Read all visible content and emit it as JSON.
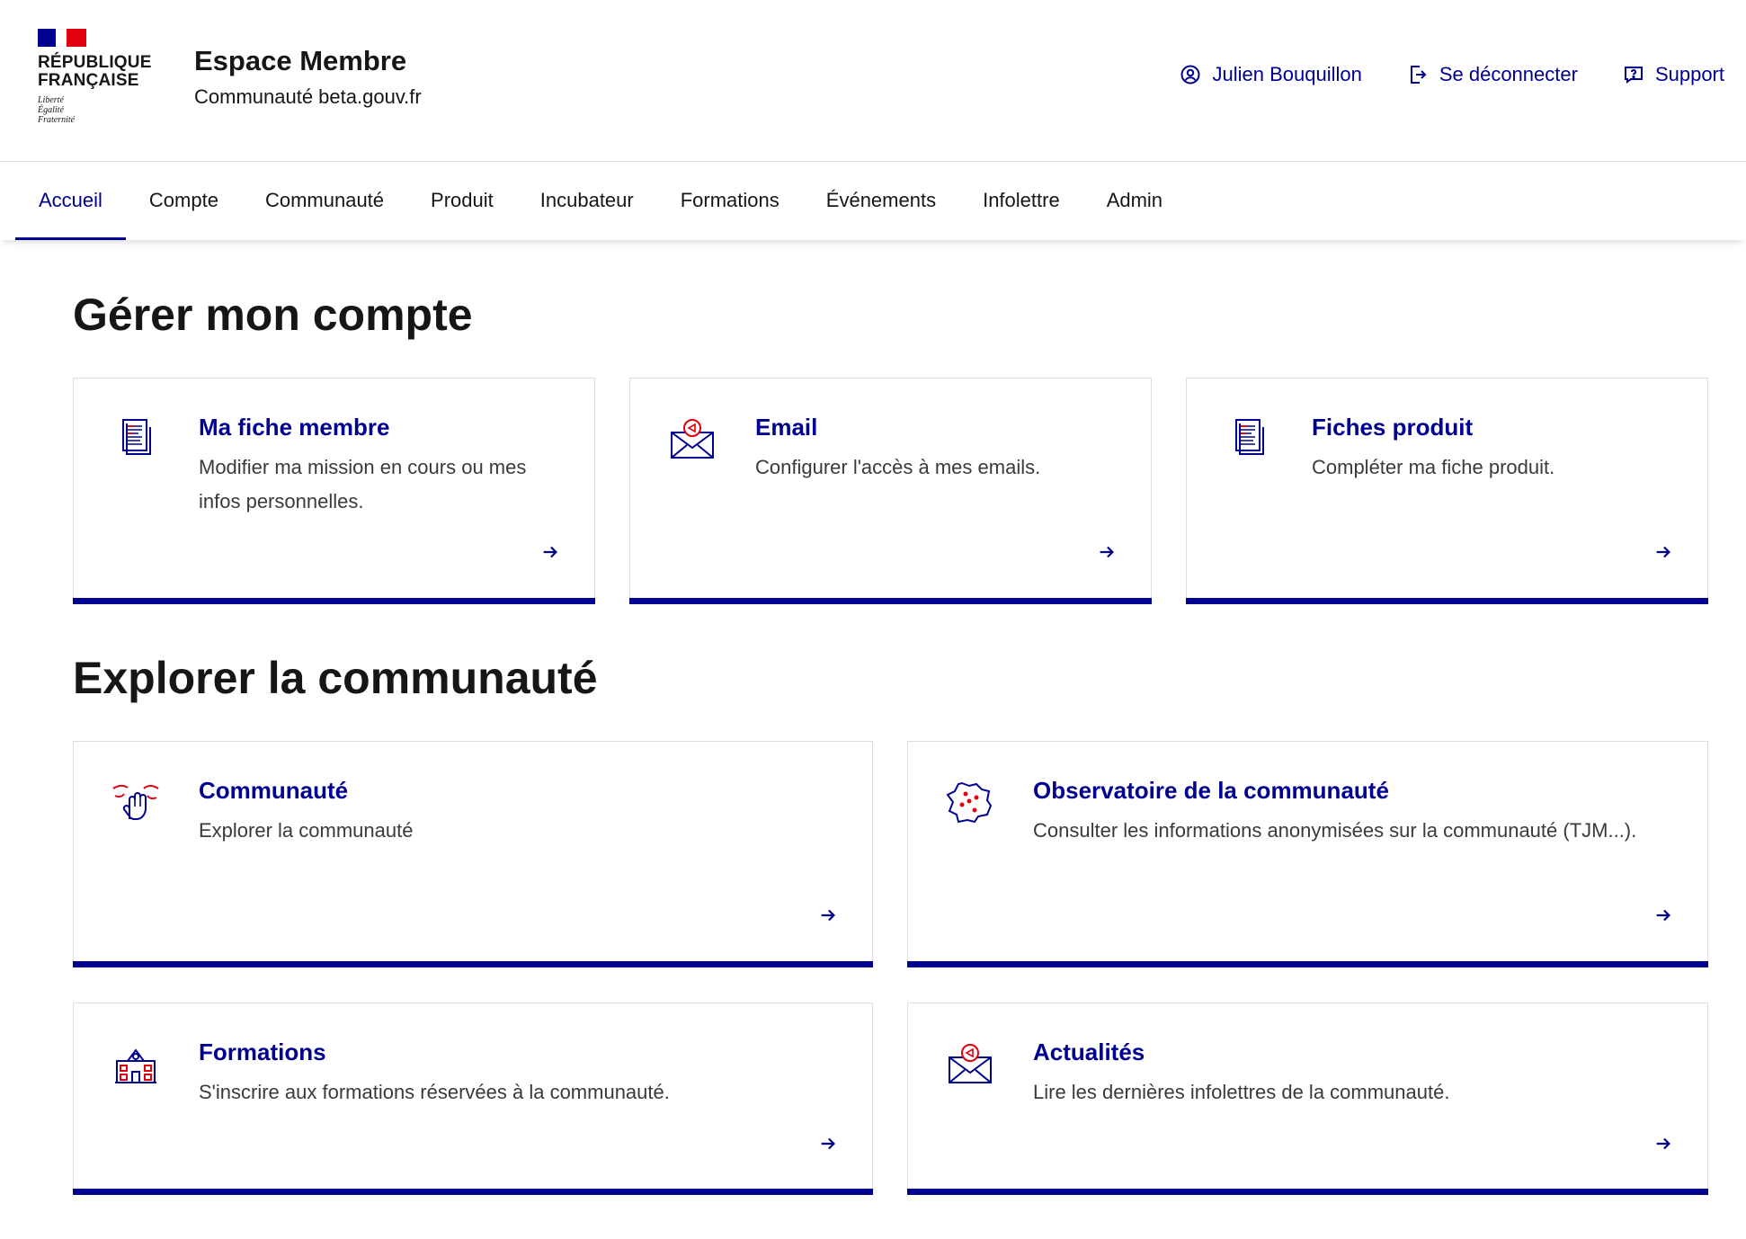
{
  "header": {
    "logo_text": "RÉPUBLIQUE FRANÇAISE",
    "logo_line1": "RÉPUBLIQUE",
    "logo_line2": "FRANÇAISE",
    "motto": [
      "Liberté",
      "Égalité",
      "Fraternité"
    ],
    "service_title": "Espace Membre",
    "service_tagline": "Communauté beta.gouv.fr",
    "tools": [
      {
        "label": "Julien Bouquillon",
        "icon": "account-circle-icon"
      },
      {
        "label": "Se déconnecter",
        "icon": "logout-box-icon"
      },
      {
        "label": "Support",
        "icon": "question-box-icon"
      }
    ]
  },
  "nav": {
    "items": [
      {
        "label": "Accueil",
        "active": true
      },
      {
        "label": "Compte"
      },
      {
        "label": "Communauté"
      },
      {
        "label": "Produit"
      },
      {
        "label": "Incubateur"
      },
      {
        "label": "Formations"
      },
      {
        "label": "Événements"
      },
      {
        "label": "Infolettre"
      },
      {
        "label": "Admin"
      }
    ]
  },
  "sections": [
    {
      "title": "Gérer mon compte",
      "cards": [
        {
          "title": "Ma fiche membre",
          "desc": "Modifier ma mission en cours ou mes infos personnelles.",
          "icon": "document-pictogram-icon"
        },
        {
          "title": "Email",
          "desc": "Configurer l'accès à mes emails.",
          "icon": "mail-send-pictogram-icon"
        },
        {
          "title": "Fiches produit",
          "desc": "Compléter ma fiche produit.",
          "icon": "document-pictogram-icon"
        }
      ]
    },
    {
      "title": "Explorer la communauté",
      "cards": [
        {
          "title": "Communauté",
          "desc": "Explorer la communauté",
          "icon": "community-hands-pictogram-icon"
        },
        {
          "title": "Observatoire de la communauté",
          "desc": "Consulter les informations anonymisées sur la communauté (TJM...).",
          "icon": "france-map-pictogram-icon"
        },
        {
          "title": "Formations",
          "desc": "S'inscrire aux formations réservées à la communauté.",
          "icon": "school-building-pictogram-icon"
        },
        {
          "title": "Actualités",
          "desc": "Lire les dernières infolettres de la communauté.",
          "icon": "mail-send-pictogram-icon"
        }
      ]
    }
  ],
  "colors": {
    "primary": "#000091",
    "accent_red": "#e1000f",
    "text": "#161616",
    "text_muted": "#3a3a3a",
    "border": "#dddddd"
  }
}
